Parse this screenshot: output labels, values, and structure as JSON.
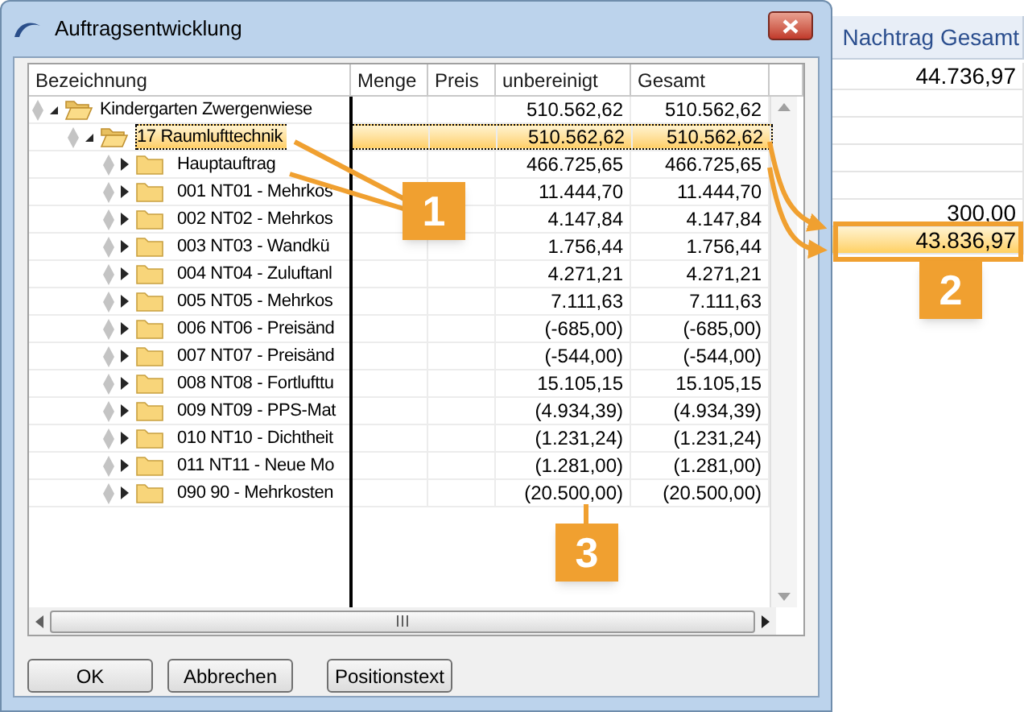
{
  "window": {
    "title": "Auftragsentwicklung"
  },
  "table": {
    "columns": [
      "Bezeichnung",
      "Menge",
      "Preis",
      "unbereinigt",
      "Gesamt"
    ],
    "rows": [
      {
        "label": "Kindergarten Zwergenwiese",
        "unbereinigt": "510.562,62",
        "gesamt": "510.562,62",
        "expanded": true,
        "selected": false,
        "children": [
          {
            "label": "17 Raumlufttechnik",
            "unbereinigt": "510.562,62",
            "gesamt": "510.562,62",
            "expanded": true,
            "selected": true,
            "children": [
              {
                "label": "Hauptauftrag",
                "unbereinigt": "466.725,65",
                "gesamt": "466.725,65",
                "expanded": false,
                "selected": false
              },
              {
                "label": "001 NT01 - Mehrkos",
                "unbereinigt": "11.444,70",
                "gesamt": "11.444,70",
                "expanded": false,
                "selected": false
              },
              {
                "label": "002 NT02 - Mehrkos",
                "unbereinigt": "4.147,84",
                "gesamt": "4.147,84",
                "expanded": false,
                "selected": false
              },
              {
                "label": "003 NT03 - Wandkü",
                "unbereinigt": "1.756,44",
                "gesamt": "1.756,44",
                "expanded": false,
                "selected": false
              },
              {
                "label": "004 NT04 - Zuluftanl",
                "unbereinigt": "4.271,21",
                "gesamt": "4.271,21",
                "expanded": false,
                "selected": false
              },
              {
                "label": "005 NT05 - Mehrkos",
                "unbereinigt": "7.111,63",
                "gesamt": "7.111,63",
                "expanded": false,
                "selected": false
              },
              {
                "label": "006 NT06 - Preisänd",
                "unbereinigt": "(-685,00)",
                "gesamt": "(-685,00)",
                "expanded": false,
                "selected": false
              },
              {
                "label": "007 NT07 - Preisänd",
                "unbereinigt": "(-544,00)",
                "gesamt": "(-544,00)",
                "expanded": false,
                "selected": false
              },
              {
                "label": "008 NT08 - Fortlufttu",
                "unbereinigt": "15.105,15",
                "gesamt": "15.105,15",
                "expanded": false,
                "selected": false
              },
              {
                "label": "009 NT09 - PPS-Mat",
                "unbereinigt": "(4.934,39)",
                "gesamt": "(4.934,39)",
                "expanded": false,
                "selected": false
              },
              {
                "label": "010 NT10 - Dichtheit",
                "unbereinigt": "(1.231,24)",
                "gesamt": "(1.231,24)",
                "expanded": false,
                "selected": false
              },
              {
                "label": "011 NT11 - Neue Mo",
                "unbereinigt": "(1.281,00)",
                "gesamt": "(1.281,00)",
                "expanded": false,
                "selected": false
              },
              {
                "label": "090 90 - Mehrkosten",
                "unbereinigt": "(20.500,00)",
                "gesamt": "(20.500,00)",
                "expanded": false,
                "selected": false
              }
            ]
          }
        ]
      }
    ]
  },
  "buttons": [
    "OK",
    "Abbrechen",
    "Positionstext"
  ],
  "background_grid": {
    "header": "Nachtrag Gesamt",
    "cells": [
      {
        "value": "44.736,97",
        "selected": false
      },
      {
        "value": "300,00",
        "selected": false
      },
      {
        "value": "43.836,97",
        "selected": true
      }
    ]
  },
  "callouts": [
    "1",
    "2",
    "3"
  ]
}
